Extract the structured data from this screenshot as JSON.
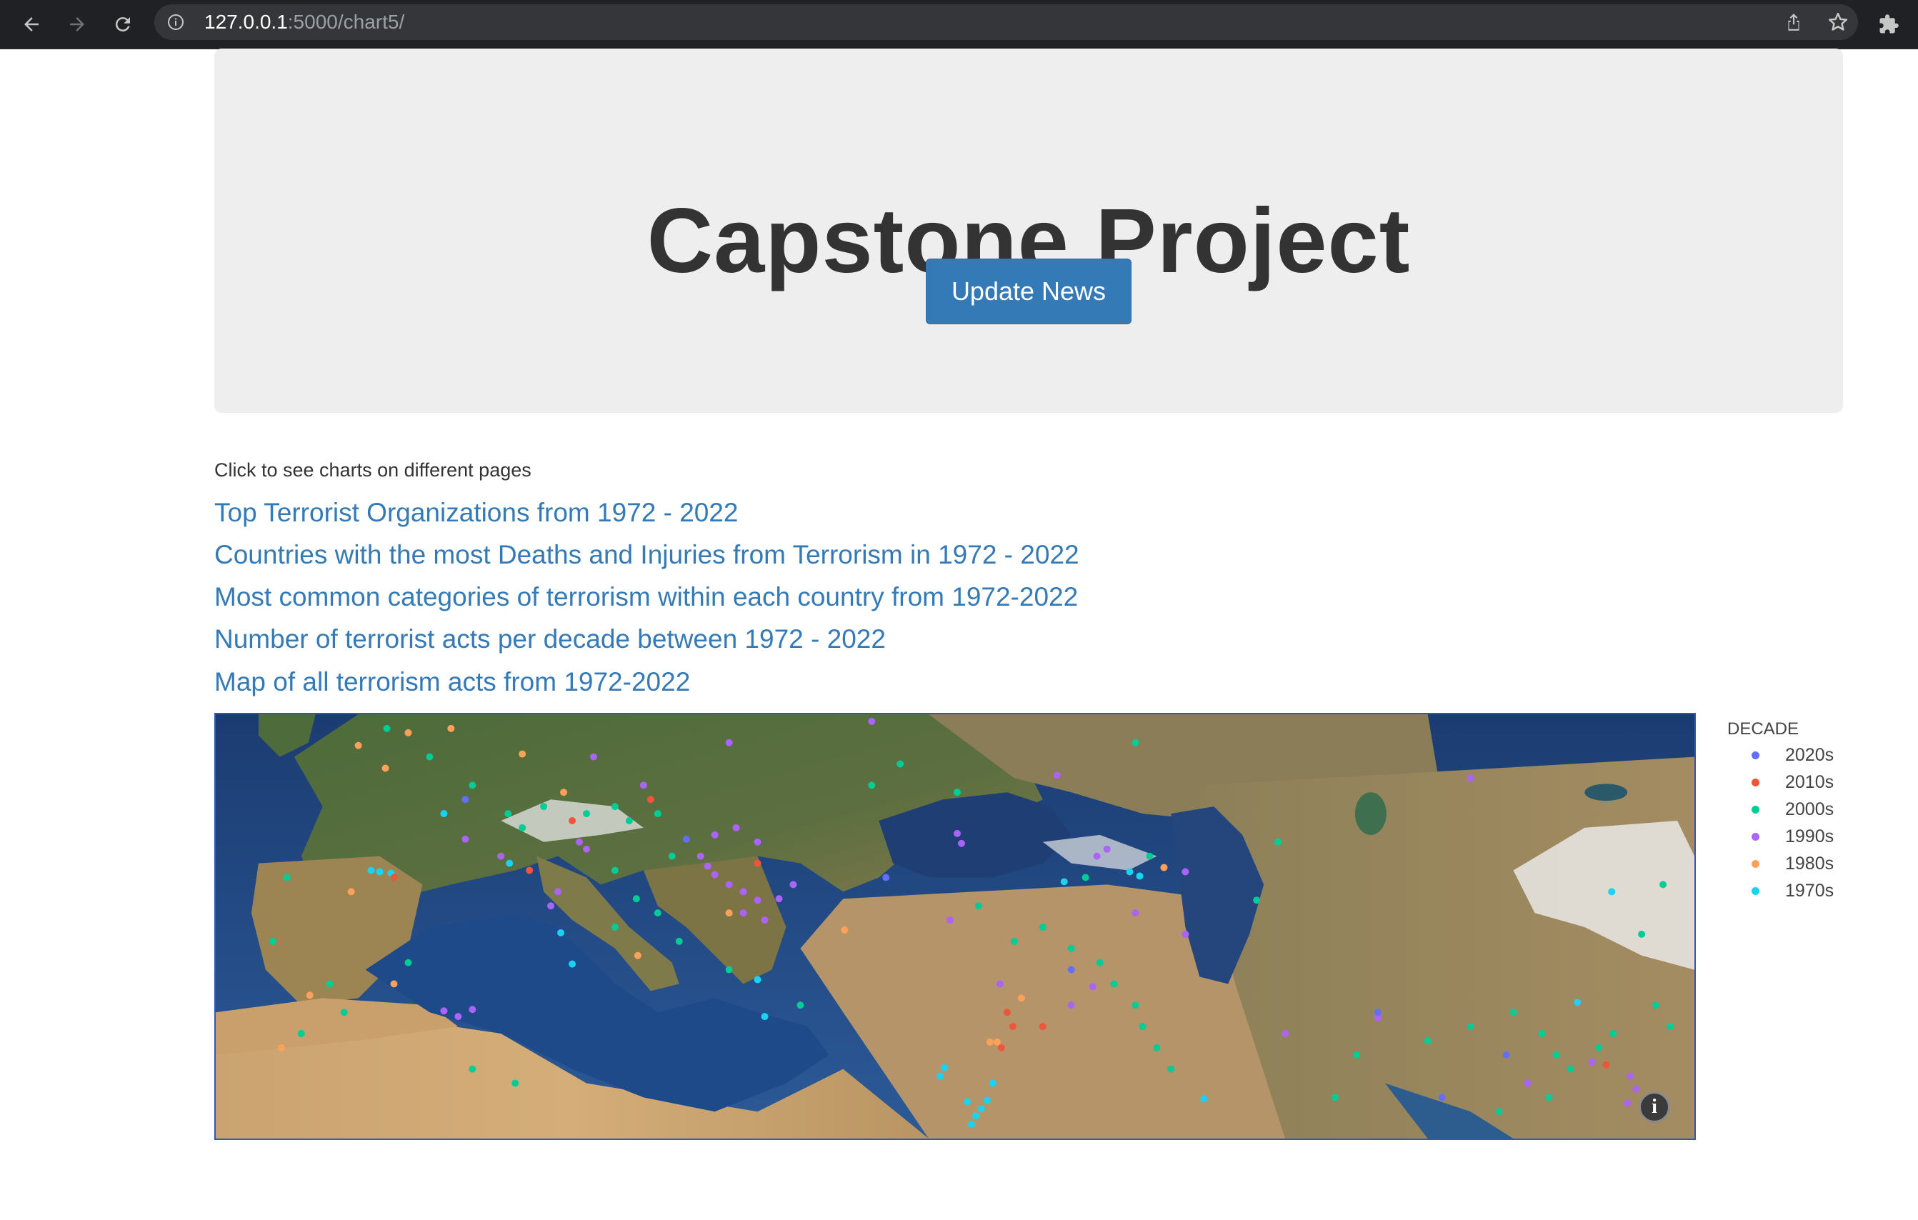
{
  "browser": {
    "url_host": "127.0.0.1",
    "url_rest": ":5000/chart5/"
  },
  "header": {
    "title": "Capstone Project",
    "update_button": "Update News"
  },
  "links": {
    "intro": "Click to see charts on different pages",
    "items": [
      "Top Terrorist Organizations from 1972 - 2022",
      "Countries with the most Deaths and Injuries from Terrorism in 1972 - 2022",
      "Most common categories of terrorism within each country from 1972-2022",
      "Number of terrorist acts per decade between 1972 - 2022",
      "Map of all terrorism acts from 1972-2022"
    ]
  },
  "map": {
    "legend_title": "DECADE",
    "legend": [
      {
        "label": "2020s",
        "color": "#636efa"
      },
      {
        "label": "2010s",
        "color": "#ef553b"
      },
      {
        "label": "2000s",
        "color": "#00cc96"
      },
      {
        "label": "1990s",
        "color": "#ab63fa"
      },
      {
        "label": "1980s",
        "color": "#ffa15a"
      },
      {
        "label": "1970s",
        "color": "#19d3f3"
      }
    ],
    "info_icon": "info-icon"
  }
}
